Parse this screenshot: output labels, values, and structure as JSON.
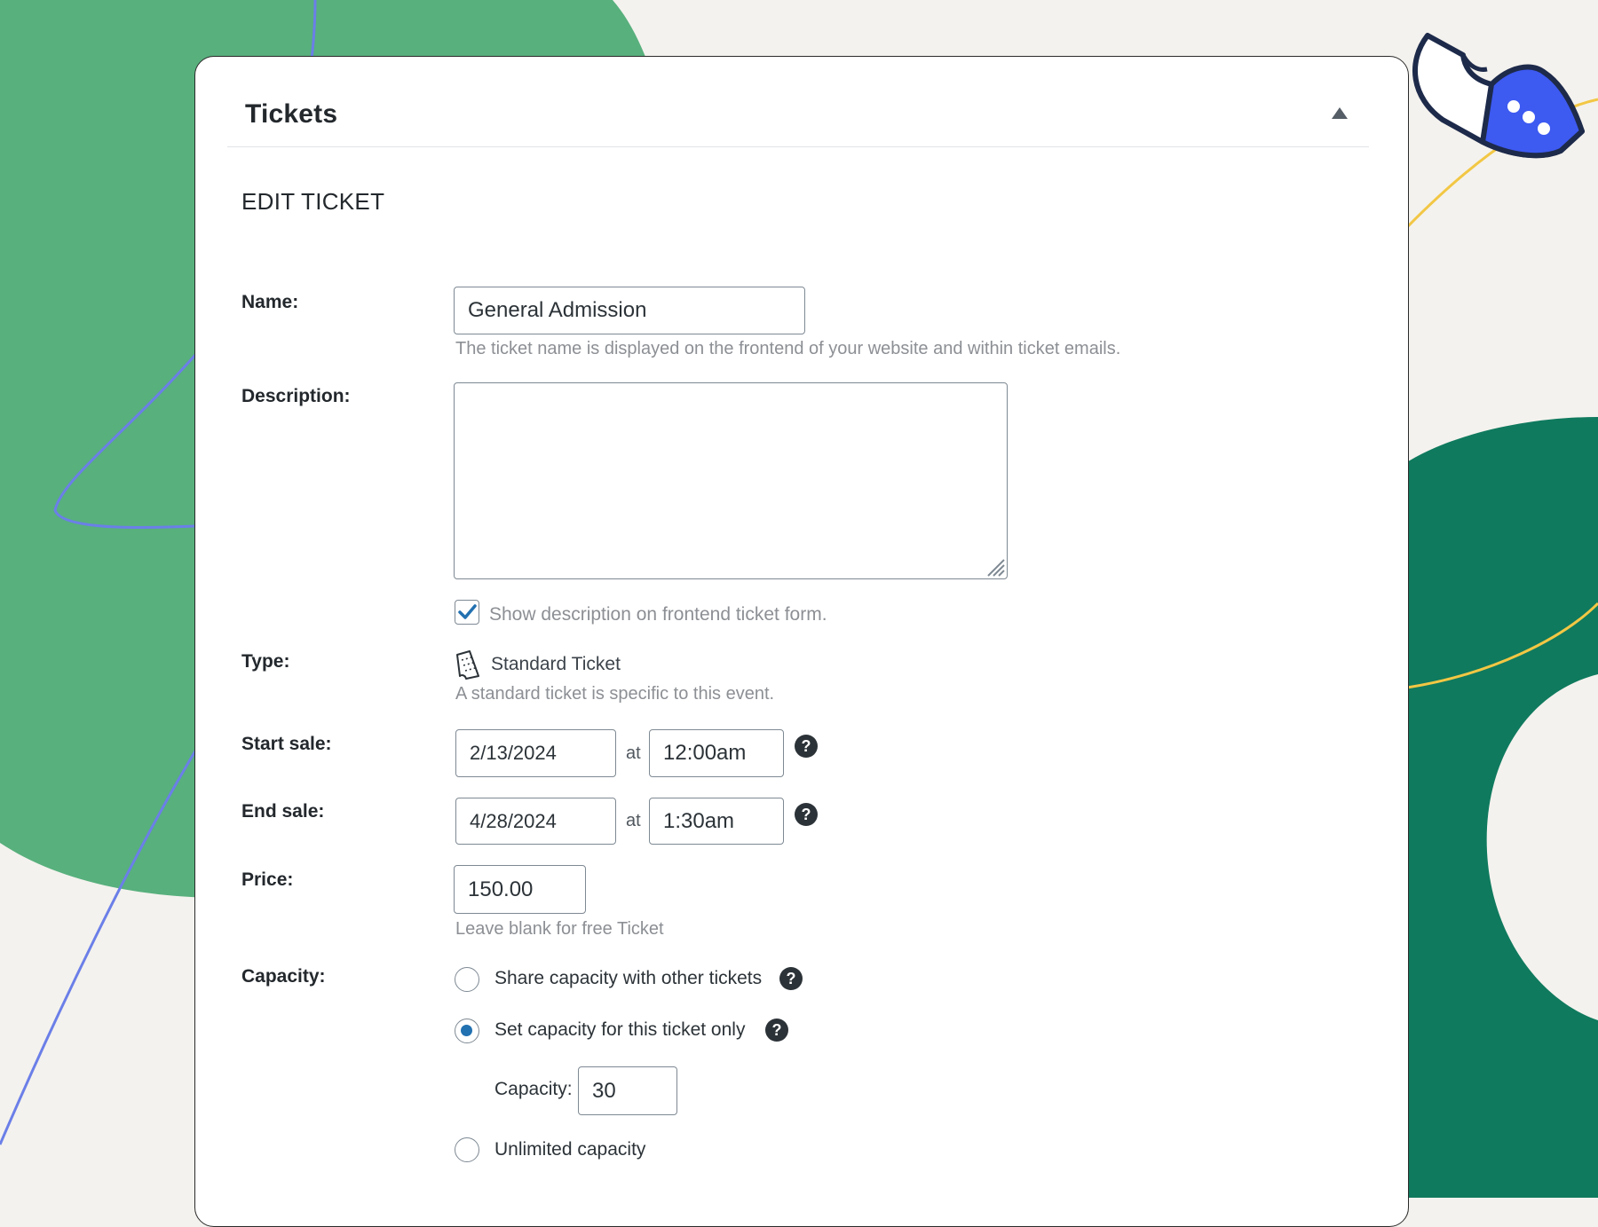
{
  "panel": {
    "title": "Tickets",
    "collapse_icon": "triangle-up-icon"
  },
  "section": {
    "heading": "EDIT TICKET"
  },
  "form": {
    "name": {
      "label": "Name:",
      "value": "General Admission",
      "hint": "The ticket name is displayed on the frontend of your website and within ticket emails."
    },
    "description": {
      "label": "Description:",
      "value": "",
      "show_on_frontend": true,
      "checkbox_label": "Show description on frontend ticket form."
    },
    "type": {
      "label": "Type:",
      "value": "Standard Ticket",
      "icon": "ticket-icon",
      "hint": "A standard ticket is specific to this event."
    },
    "start_sale": {
      "label": "Start sale:",
      "date": "2/13/2024",
      "at": "at",
      "time": "12:00am"
    },
    "end_sale": {
      "label": "End sale:",
      "date": "4/28/2024",
      "at": "at",
      "time": "1:30am"
    },
    "price": {
      "label": "Price:",
      "value": "150.00",
      "hint": "Leave blank for free Ticket"
    },
    "capacity": {
      "label": "Capacity:",
      "options": [
        {
          "label": "Share capacity with other tickets",
          "selected": false,
          "help": true
        },
        {
          "label": "Set capacity for this ticket only",
          "selected": true,
          "help": true
        },
        {
          "label": "Unlimited capacity",
          "selected": false,
          "help": false
        }
      ],
      "capacity_field_label": "Capacity:",
      "capacity_value": "30"
    },
    "help_glyph": "?"
  },
  "colors": {
    "background": "#f4f2ee",
    "light_green": "#58b07d",
    "dark_green": "#0f7a5e",
    "accent_blue": "#2271b1",
    "line_purple": "#6b7fe8",
    "line_yellow": "#f2c744",
    "ticket_blue": "#3d5af1"
  }
}
